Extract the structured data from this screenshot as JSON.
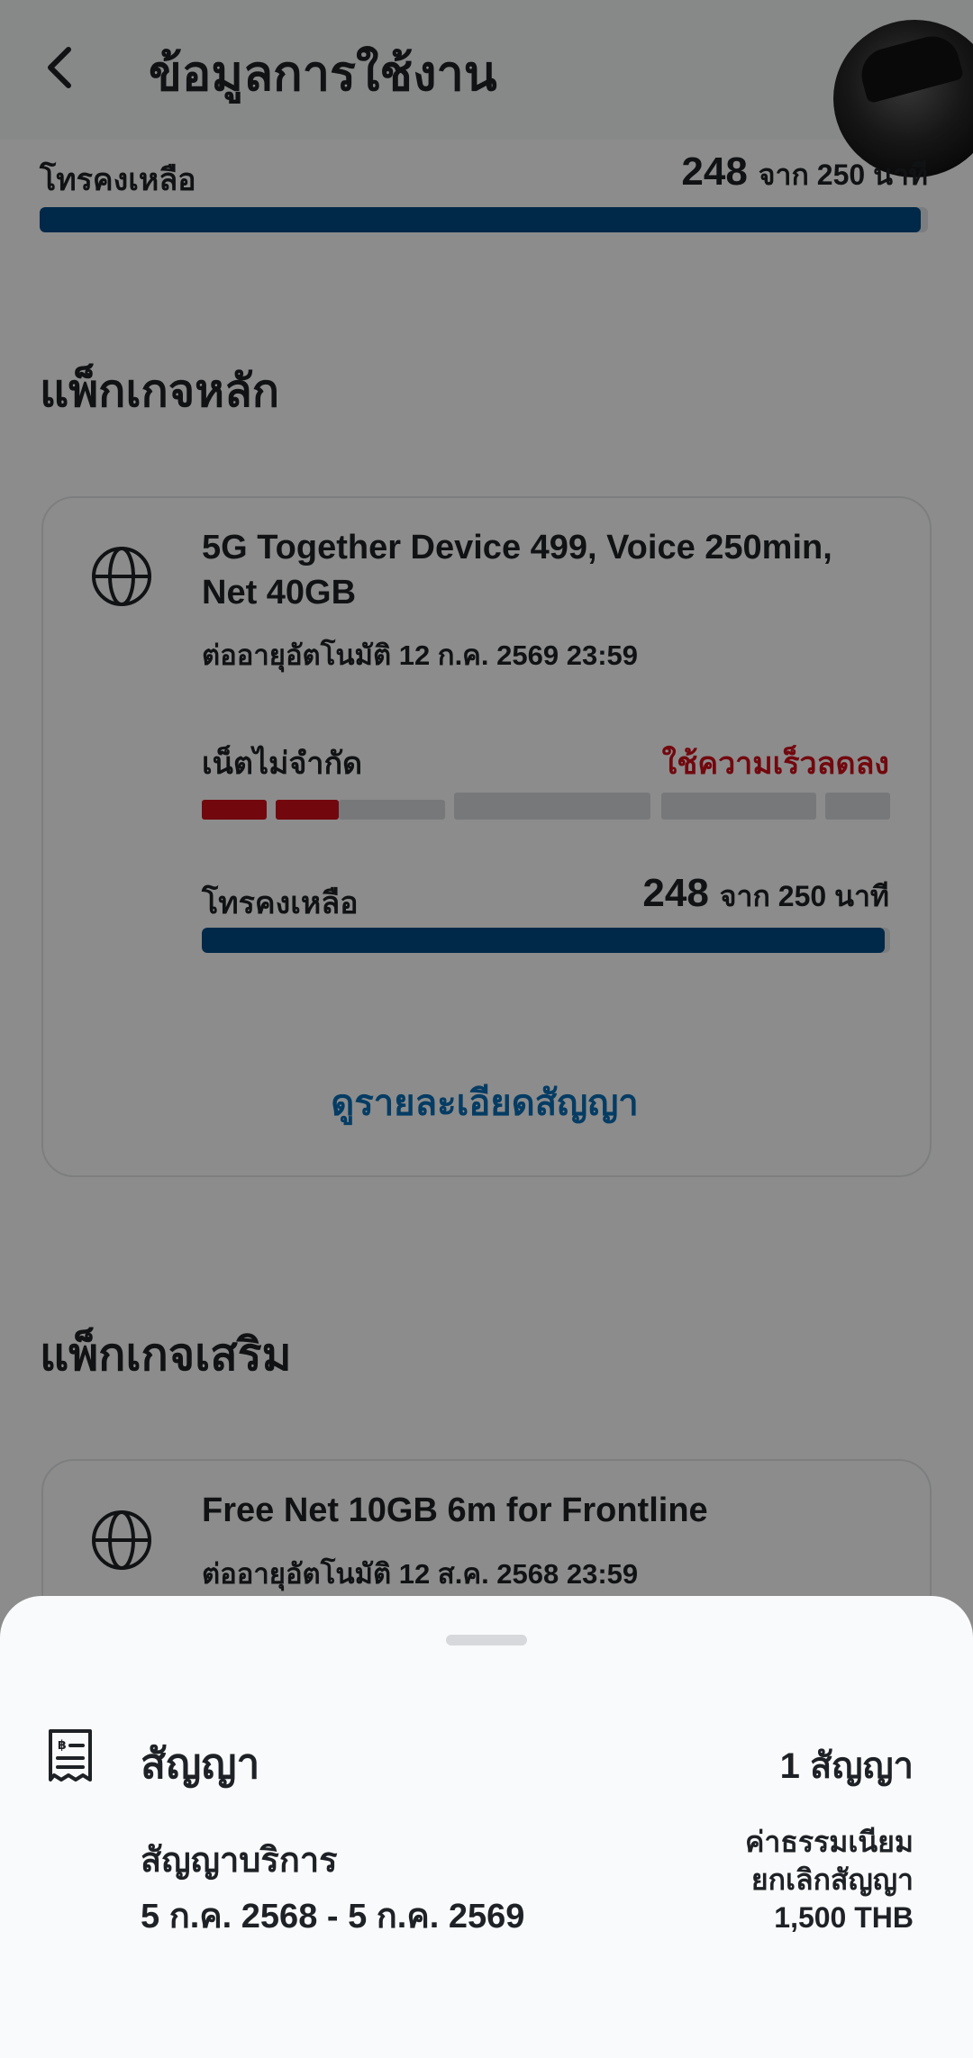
{
  "header": {
    "title": "ข้อมูลการใช้งาน"
  },
  "top_usage": {
    "label": "โทรคงเหลือ",
    "remaining": "248",
    "of_total": "จาก 250 นาที",
    "progress": 0.992
  },
  "main_package": {
    "section_title": "แพ็กเกจหลัก",
    "name": "5G Together Device 499, Voice 250min, Net 40GB",
    "renew": "ต่ออายุอัตโนมัติ 12 ก.ค. 2569 23:59",
    "net": {
      "label": "เน็ตไม่จำกัด",
      "status": "ใช้ความเร็วลดลง",
      "status_color": "#d0101b"
    },
    "voice": {
      "label": "โทรคงเหลือ",
      "remaining": "248",
      "of_total": "จาก 250 นาที",
      "progress": 0.992
    },
    "link": "ดูรายละเอียดสัญญา"
  },
  "addon_package": {
    "section_title": "แพ็กเกจเสริม",
    "name": "Free Net 10GB 6m for Frontline",
    "renew": "ต่ออายุอัตโนมัติ 12 ส.ค. 2568 23:59"
  },
  "contract_sheet": {
    "title": "สัญญา",
    "count": "1 สัญญา",
    "subtitle": "สัญญาบริการ",
    "period": "5 ก.ค. 2568 - 5 ก.ค. 2569",
    "fee_line1": "ค่าธรรมเนียม",
    "fee_line2": "ยกเลิกสัญญา",
    "fee_amount": "1,500 THB"
  },
  "colors": {
    "accent_blue": "#004a85",
    "link_blue": "#0a6eb7",
    "alert_red": "#d0101b"
  },
  "icons": [
    "back-arrow-icon",
    "globe-icon",
    "contract-receipt-icon",
    "avatar-image"
  ]
}
